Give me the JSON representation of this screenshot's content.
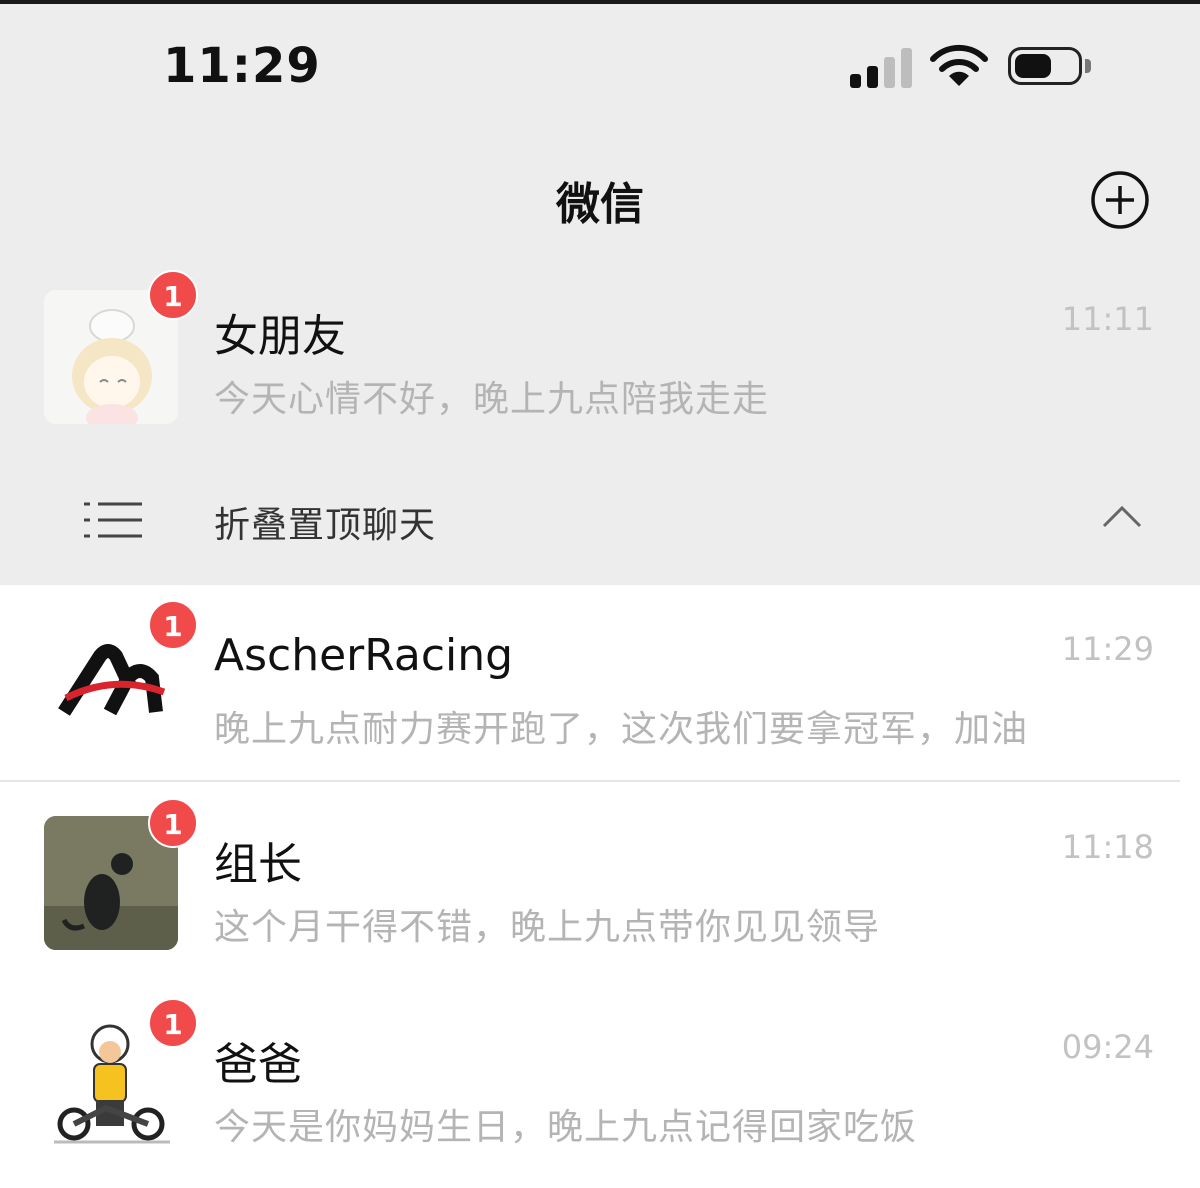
{
  "status_bar": {
    "time": "11:29",
    "signal_icon": "cellular-signal-icon",
    "wifi_icon": "wifi-icon",
    "battery_icon": "battery-icon",
    "battery_level": 0.6
  },
  "nav": {
    "title": "微信",
    "add_icon": "plus-circle-icon"
  },
  "pinned": [
    {
      "name": "女朋友",
      "preview": "今天心情不好，晚上九点陪我走走",
      "time": "11:11",
      "badge": "1",
      "avatar": "anime-girl-avatar"
    }
  ],
  "fold": {
    "label": "折叠置顶聊天",
    "icon": "list-icon",
    "chevron": "chevron-up-icon"
  },
  "chats": [
    {
      "name": "AscherRacing",
      "preview": "晚上九点耐力赛开跑了，这次我们要拿冠军，加油",
      "time": "11:29",
      "badge": "1",
      "avatar": "racing-logo-avatar"
    },
    {
      "name": "组长",
      "preview": "这个月干得不错，晚上九点带你见见领导",
      "time": "11:18",
      "badge": "1",
      "avatar": "cat-photo-avatar"
    },
    {
      "name": "爸爸",
      "preview": "今天是你妈妈生日，晚上九点记得回家吃饭",
      "time": "09:24",
      "badge": "1",
      "avatar": "motorcycle-man-avatar"
    }
  ],
  "colors": {
    "badge": "#f04a4a",
    "header_bg": "#ededed",
    "list_bg": "#ffffff"
  }
}
